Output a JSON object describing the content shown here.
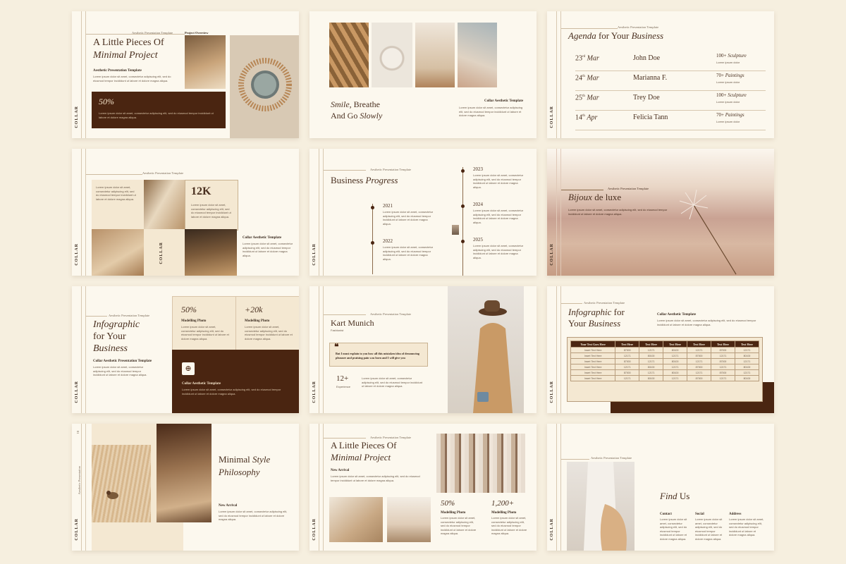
{
  "brand": "COLLAR",
  "lorem": "Lorem ipsum dolor sit amet, consectetur adipiscing elit, sed do eiusmod tempor incididunt ut labore et dolore magna aliqua.",
  "s1": {
    "kicker": "Aesthetic Presentation Template",
    "label": "Project Overview",
    "title_a": "A Little Pieces Of",
    "title_b": "Minimal Project",
    "sub": "Aesthetic Presentation Template",
    "pct": "50%"
  },
  "s2": {
    "title_a": "Smile",
    ", Breathe": "",
    "title_b": ", Breathe",
    "title_c": "And Go ",
    "title_d": "Slowly",
    "sub": "Collar Aesthetic Template"
  },
  "s3": {
    "kicker": "Aesthetic Presentation Template",
    "title_a": "Agenda",
    "title_b": " for Your ",
    "title_c": "Business",
    "rows": [
      {
        "day": "23",
        "sup": "rd",
        "mon": "Mar",
        "name": "John Doe",
        "count": "100+",
        "what": "Sculpture",
        "note": "Lorem ipsum dolor"
      },
      {
        "day": "24",
        "sup": "th",
        "mon": "Mar",
        "name": "Marianna F.",
        "count": "70+",
        "what": "Paintings",
        "note": "Lorem ipsum dolor"
      },
      {
        "day": "25",
        "sup": "th",
        "mon": "Mar",
        "name": "Trey Doe",
        "count": "100+",
        "what": "Sculpture",
        "note": "Lorem ipsum dolor"
      },
      {
        "day": "14",
        "sup": "th",
        "mon": "Apr",
        "name": "Felicia Tann",
        "count": "70+",
        "what": "Paintings",
        "note": "Lorem ipsum dolor"
      }
    ]
  },
  "s4": {
    "kicker": "Aesthetic Presentation Template",
    "stat": "12K",
    "sub": "Collar Aesthetic Template"
  },
  "s5": {
    "kicker": "Aesthetic Presentation Template",
    "title_a": "Business ",
    "title_b": "Progress",
    "years": [
      "2021",
      "2022",
      "2023",
      "2024",
      "2025"
    ]
  },
  "s6": {
    "kicker": "Aesthetic Presentation Template",
    "title_a": "Bijoux",
    "title_b": " de luxe"
  },
  "s7": {
    "kicker": "Aesthetic Presentation Template",
    "title_a": "Infographic",
    "title_b": "for Your",
    "title_c": "Business",
    "sub": "Collar Aesthetic Presentation Template",
    "stat1": "50%",
    "stat1_label": "Modelling Photo",
    "stat2": "+20k",
    "stat2_label": "Modelling Photo",
    "card_title": "Collar Aesthetic Template"
  },
  "s8": {
    "kicker": "Aesthetic Presentation Template",
    "name": "Kart Munich",
    "role": "Fashionist",
    "quote": "But I must explain to you how all this mistaken idea of denouncing pleasure and praising pain was born and I will give you",
    "stat": "12+",
    "stat_label": "Experience"
  },
  "s9": {
    "kicker": "Aesthetic Presentation Template",
    "title_a": "Infographic",
    "title_b": " for",
    "title_c": "Your ",
    "title_d": "Business",
    "sub": "Collar Aesthetic Template",
    "headers": [
      "Your Text Goes Here",
      "Text Here",
      "Text Here",
      "Text Here",
      "Text Here",
      "Text Here",
      "Text Here"
    ],
    "rows": [
      [
        "Insert Text Here",
        "87000",
        "12171",
        "80100",
        "12171",
        "87000",
        "12171"
      ],
      [
        "Insert Text Here",
        "12171",
        "80100",
        "12171",
        "87000",
        "12171",
        "80100"
      ],
      [
        "Insert Text Here",
        "87000",
        "12171",
        "80100",
        "12171",
        "87000",
        "12171"
      ],
      [
        "Insert Text Here",
        "12171",
        "80100",
        "12171",
        "87000",
        "12171",
        "80100"
      ],
      [
        "Insert Text Here",
        "87000",
        "12171",
        "80100",
        "12171",
        "87000",
        "12171"
      ],
      [
        "Insert Text Here",
        "12171",
        "80100",
        "12171",
        "87000",
        "12171",
        "80100"
      ]
    ]
  },
  "s10": {
    "kicker": "Aesthetic Presentation",
    "title_a": "Minimal ",
    "title_b": "Style",
    "title_c": "Philosophy",
    "sub": "New Arrival",
    "page": "01"
  },
  "s11": {
    "kicker": "Aesthetic Presentation Template",
    "title_a": "A Little Pieces Of",
    "title_b": "Minimal Project",
    "sub": "New Arrival",
    "stat1": "50%",
    "stat1_label": "Modelling Photo",
    "stat2": "1,200+",
    "stat2_label": "Modelling Photo"
  },
  "s12": {
    "kicker": "Aesthetic Presentation Template",
    "title_a": "Find ",
    "title_b": "Us",
    "c1": "Contact",
    "c2": "Social",
    "c3": "Address"
  },
  "colors": {
    "bg": "#f6efdf",
    "slide": "#fcf8ee",
    "brown": "#4a2511",
    "accent": "#8b6a4a"
  }
}
